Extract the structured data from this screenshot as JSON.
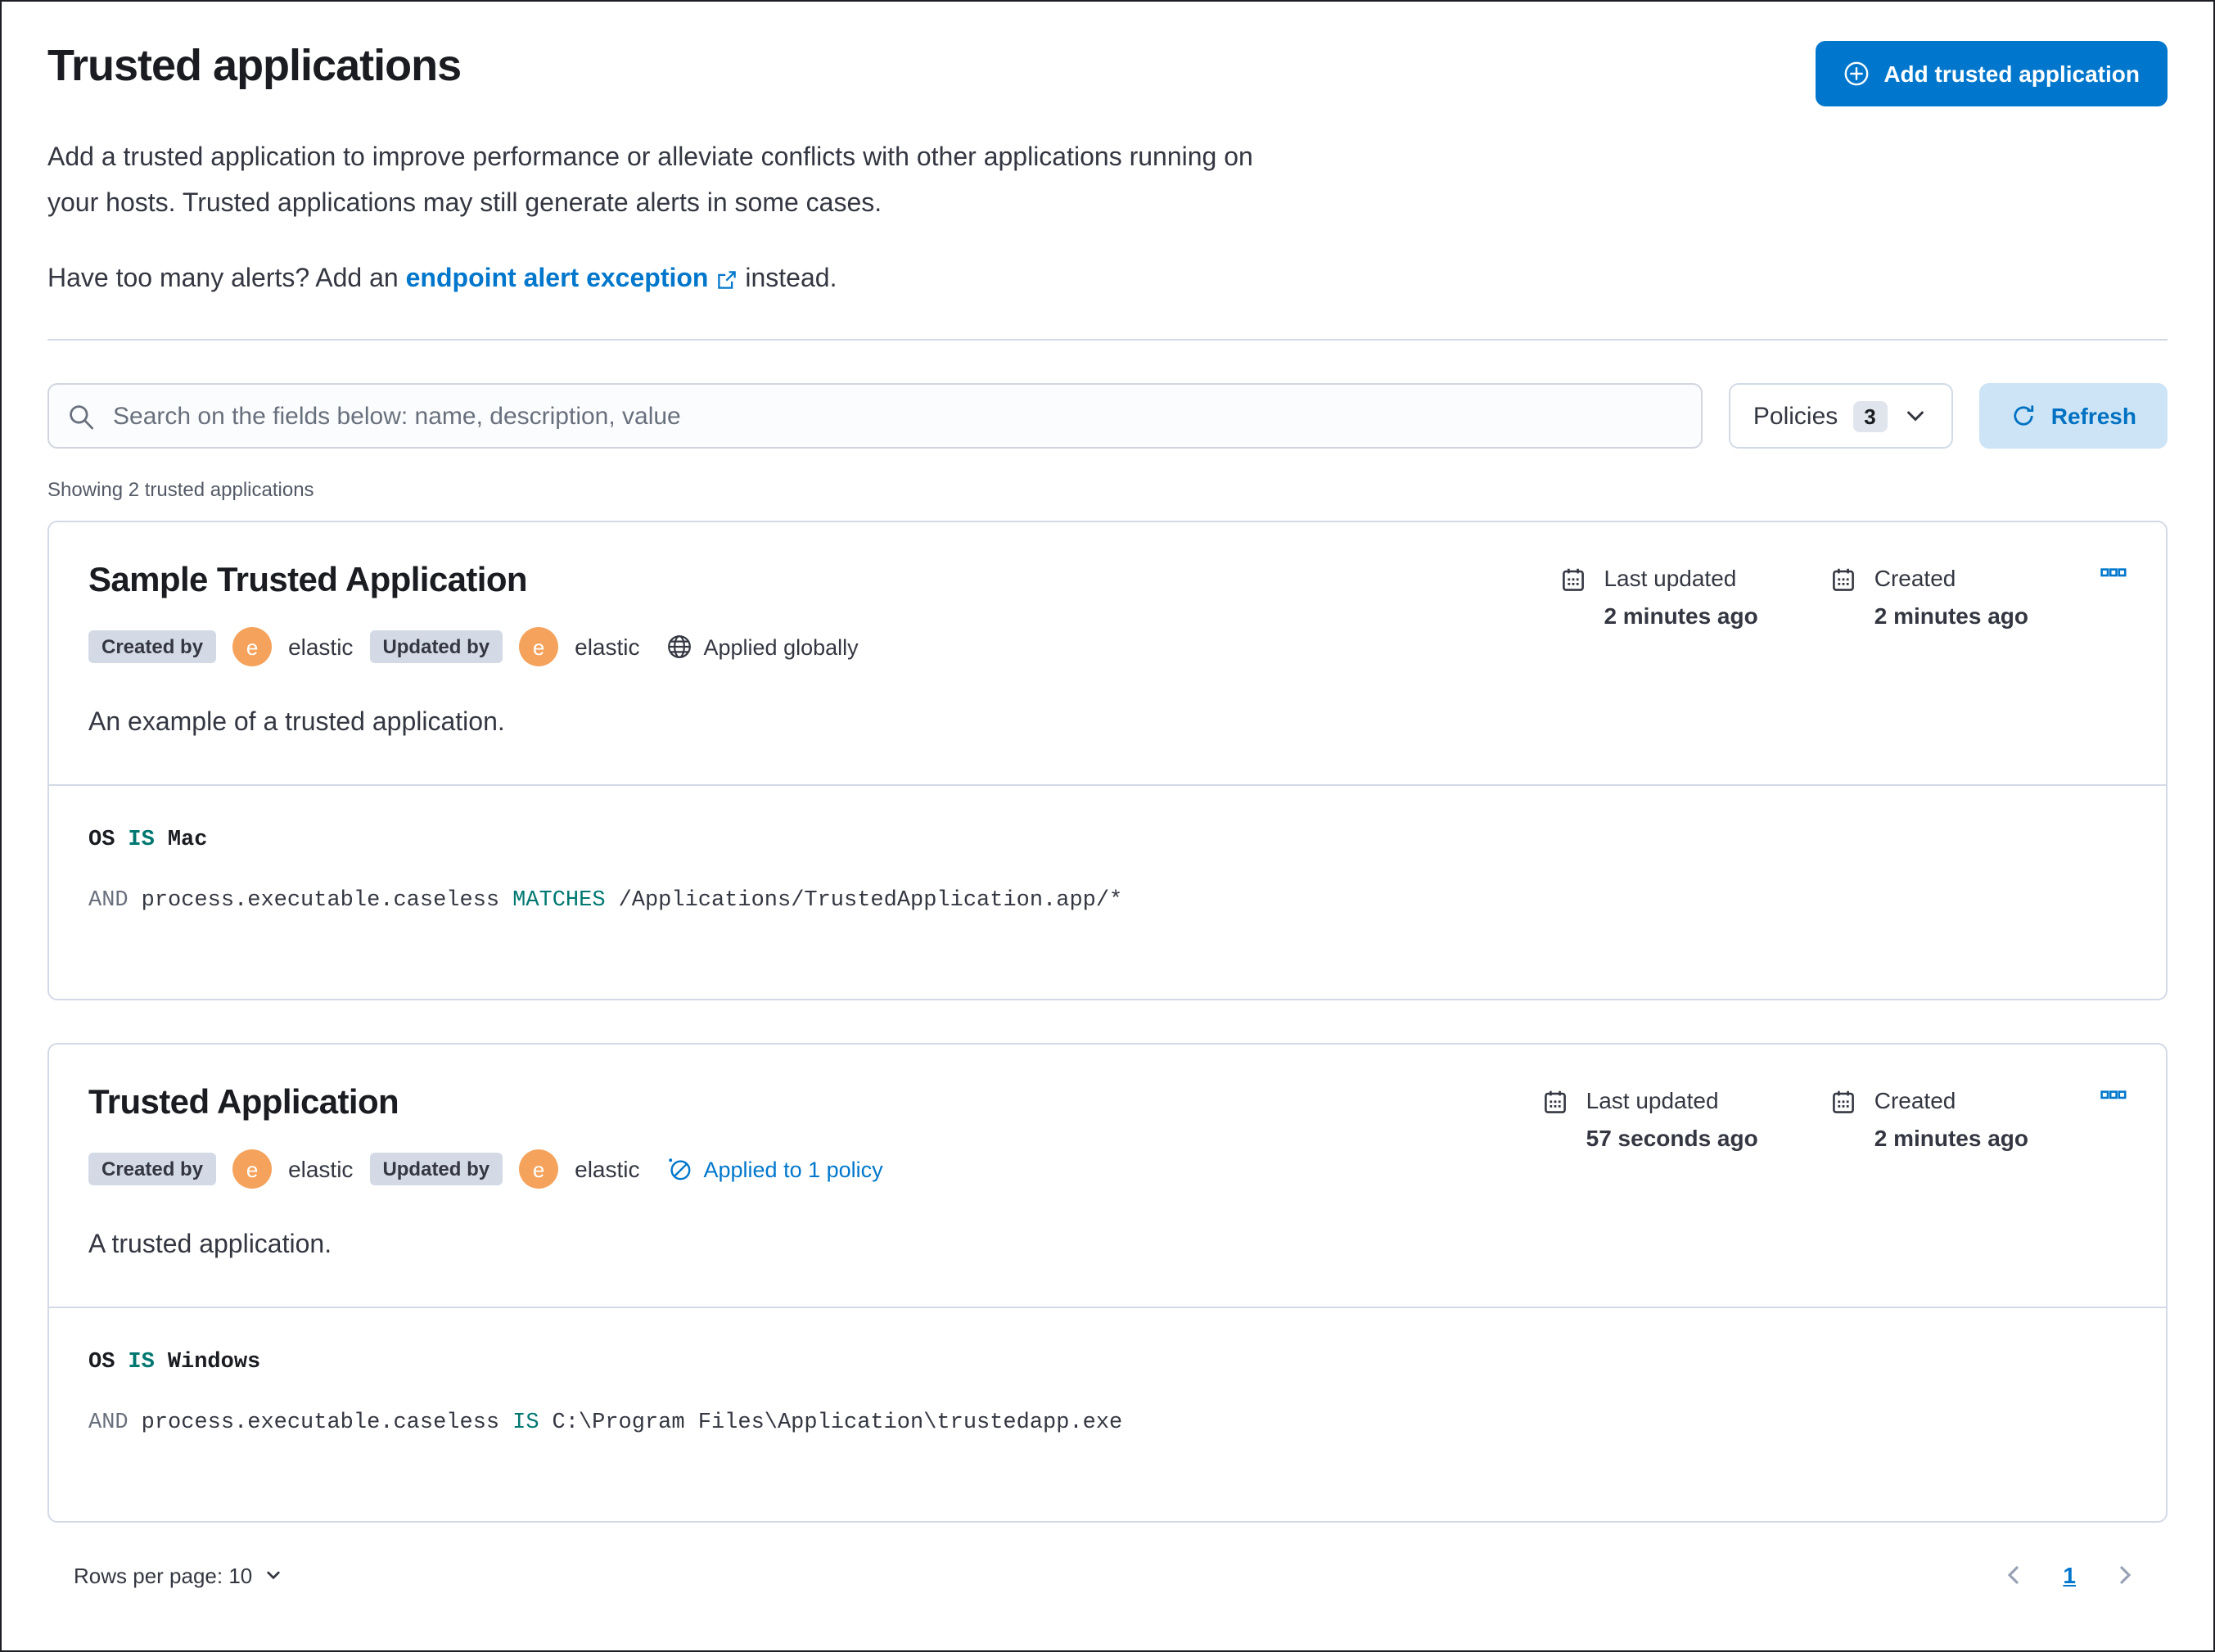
{
  "page": {
    "title": "Trusted applications",
    "description_line1": "Add a trusted application to improve performance or alleviate conflicts with other applications running on",
    "description_line2": "your hosts. Trusted applications may still generate alerts in some cases.",
    "alerts_prefix": "Have too many alerts? Add an",
    "alerts_link": "endpoint alert exception",
    "alerts_suffix": "instead.",
    "add_button": "Add trusted application",
    "search_placeholder": "Search on the fields below: name, description, value",
    "policies_label": "Policies",
    "policies_count": "3",
    "refresh_label": "Refresh",
    "showing_text": "Showing 2 trusted applications",
    "rows_per_page": "Rows per page: 10",
    "page_number": "1"
  },
  "colors": {
    "primary_blue": "#0077cc",
    "refresh_bg": "#cce4f5",
    "badge_gray": "#d3dae6",
    "avatar_orange": "#f5a35c",
    "operator_teal": "#007871",
    "muted_gray": "#69707d"
  },
  "cards": [
    {
      "title": "Sample Trusted Application",
      "created_by_label": "Created by",
      "created_by_user": "elastic",
      "updated_by_label": "Updated by",
      "updated_by_user": "elastic",
      "avatar_letter": "e",
      "scope_label": "Applied globally",
      "last_updated_label": "Last updated",
      "last_updated_value": "2 minutes ago",
      "created_label": "Created",
      "created_value": "2 minutes ago",
      "description": "An example of a trusted application.",
      "criteria": [
        {
          "prefix": "",
          "field": "OS",
          "operator": "IS",
          "value": "Mac"
        },
        {
          "prefix": "AND",
          "field": "process.executable.caseless",
          "operator": "MATCHES",
          "value": "/Applications/TrustedApplication.app/*"
        }
      ]
    },
    {
      "title": "Trusted Application",
      "created_by_label": "Created by",
      "created_by_user": "elastic",
      "updated_by_label": "Updated by",
      "updated_by_user": "elastic",
      "avatar_letter": "e",
      "scope_label": "Applied to 1 policy",
      "last_updated_label": "Last updated",
      "last_updated_value": "57 seconds ago",
      "created_label": "Created",
      "created_value": "2 minutes ago",
      "description": "A trusted application.",
      "criteria": [
        {
          "prefix": "",
          "field": "OS",
          "operator": "IS",
          "value": "Windows"
        },
        {
          "prefix": "AND",
          "field": "process.executable.caseless",
          "operator": "IS",
          "value": "C:\\Program Files\\Application\\trustedapp.exe"
        }
      ]
    }
  ]
}
